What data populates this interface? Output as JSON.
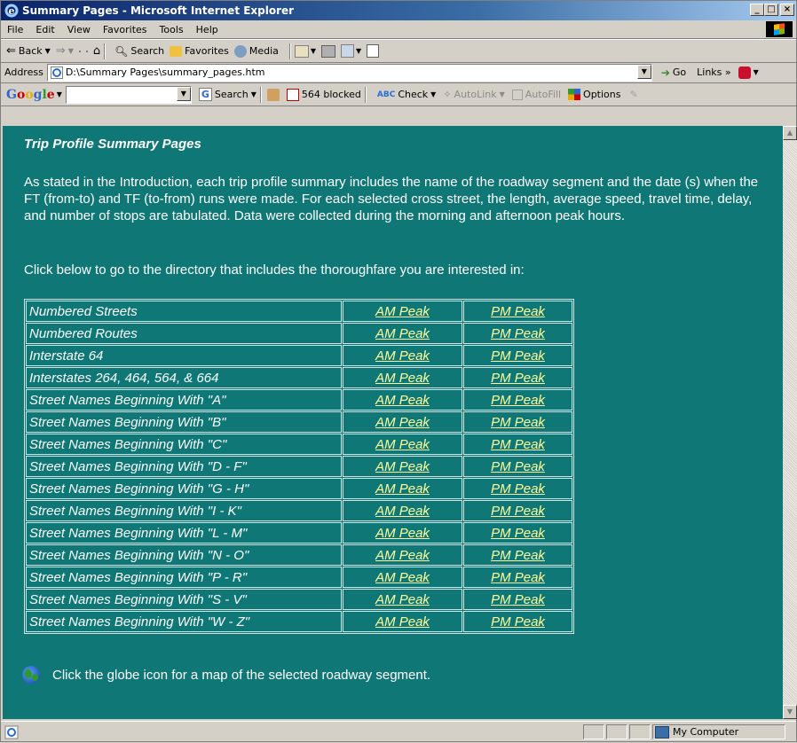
{
  "window": {
    "title": "Summary Pages - Microsoft Internet Explorer"
  },
  "menu": [
    "File",
    "Edit",
    "View",
    "Favorites",
    "Tools",
    "Help"
  ],
  "toolbar": {
    "back": "Back",
    "search": "Search",
    "favorites": "Favorites",
    "media": "Media"
  },
  "address": {
    "label": "Address",
    "value": "D:\\Summary Pages\\summary_pages.htm",
    "go": "Go",
    "links": "Links »"
  },
  "googlebar": {
    "logo": "Google",
    "search": "Search",
    "blocked": "564 blocked",
    "check": "Check",
    "autolink": "AutoLink",
    "autofill": "AutoFill",
    "options": "Options"
  },
  "page": {
    "title": "Trip Profile Summary Pages",
    "intro": "As stated in the Introduction, each trip profile summary includes the name of the roadway segment and the date (s) when the FT (from-to) and TF (to-from) runs were made.  For each selected cross street, the length, average speed, travel time, delay, and number of stops are tabulated.  Data were collected during the morning and afternoon peak hours.",
    "click_below": "Click below to go to the directory that includes the thoroughfare you are interested in:",
    "am_label": "AM Peak",
    "pm_label": "PM Peak",
    "rows": [
      "Numbered Streets",
      "Numbered Routes",
      "Interstate 64",
      "Interstates 264, 464, 564, & 664",
      "Street Names Beginning With \"A\"",
      "Street Names Beginning With \"B\"",
      "Street Names Beginning With \"C\"",
      "Street Names Beginning With \"D - F\"",
      "Street Names Beginning With \"G - H\"",
      "Street Names Beginning With \"I - K\"",
      "Street Names Beginning With \"L - M\"",
      "Street Names Beginning With \"N - O\"",
      "Street Names Beginning With \"P - R\"",
      "Street Names Beginning With \"S - V\"",
      "Street Names Beginning With \"W - Z\""
    ],
    "globe_note": "Click the globe icon for a map of the selected roadway segment."
  },
  "status": {
    "zone": "My Computer"
  },
  "colors": {
    "content_bg": "#0f7877",
    "link": "#ffff99",
    "titlebar": "#0a246a"
  }
}
